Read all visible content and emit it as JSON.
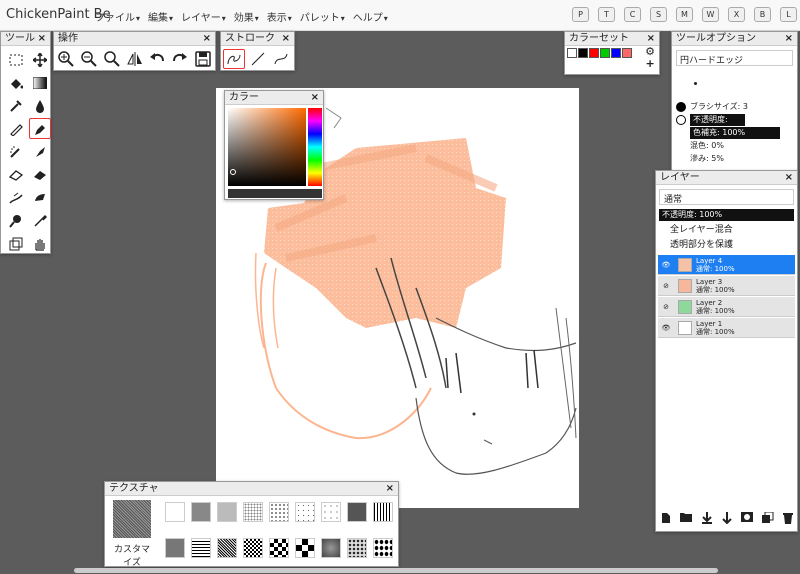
{
  "app": {
    "title": "ChickenPaint Be"
  },
  "menu": [
    "ファイル",
    "編集",
    "レイヤー",
    "効果",
    "表示",
    "パレット",
    "ヘルプ"
  ],
  "shortcuts": [
    "P",
    "T",
    "C",
    "S",
    "M",
    "W",
    "X",
    "B",
    "L"
  ],
  "tools_panel": {
    "title": "ツール",
    "close": "×"
  },
  "ops_panel": {
    "title": "操作",
    "close": "×"
  },
  "stroke_panel": {
    "title": "ストローク",
    "close": "×"
  },
  "colorset_panel": {
    "title": "カラーセット",
    "close": "×",
    "swatches": [
      "#ffffff",
      "#000000",
      "#ff0000",
      "#00cc00",
      "#0000ff",
      "#ff6666"
    ]
  },
  "color_panel": {
    "title": "カラー",
    "close": "×",
    "hue": "#ff6a00"
  },
  "tool_options": {
    "title": "ツールオプション",
    "close": "×",
    "brush_name": "円ハードエッジ",
    "brush_size": "ブラシサイズ: 3",
    "opacity": "不透明度: 128",
    "fill": "色補充: 100%",
    "mix": "混色: 0%",
    "blur": "滲み: 5%"
  },
  "layers_panel": {
    "title": "レイヤー",
    "close": "×",
    "blend_mode": "通常",
    "opacity": "不透明度: 100%",
    "merge_all": "全レイヤー混合",
    "protect_alpha": "透明部分を保護",
    "layers": [
      {
        "name": "Layer 4",
        "mode": "通常: 100%",
        "thumb": "#f5c2a8",
        "selected": true
      },
      {
        "name": "Layer 3",
        "mode": "通常: 100%",
        "thumb": "#f6b79a",
        "selected": false
      },
      {
        "name": "Layer 2",
        "mode": "通常: 100%",
        "thumb": "#8dd89a",
        "selected": false
      },
      {
        "name": "Layer 1",
        "mode": "通常: 100%",
        "thumb": "#ffffff",
        "selected": false
      }
    ]
  },
  "texture_panel": {
    "title": "テクスチャ",
    "close": "×",
    "customize": "カスタマイズ"
  },
  "colors": {
    "accent": "#1e7ff2",
    "stroke": "#fbb690",
    "active_border": "#e33333"
  }
}
